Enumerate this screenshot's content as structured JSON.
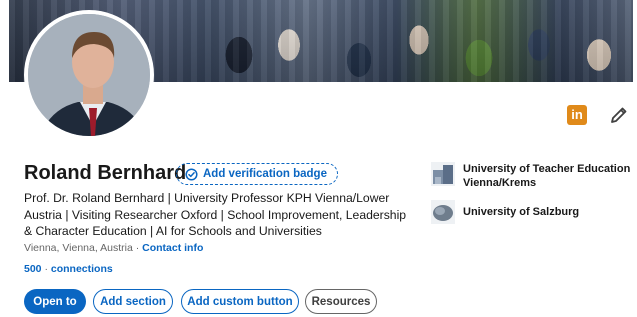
{
  "profile": {
    "name": "Roland Bernhard",
    "verification_badge_label": "Add verification badge",
    "headline": "Prof. Dr. Roland Bernhard | University Professor KPH Vienna/Lower Austria | Visiting Researcher Oxford | School Improvement, Leadership & Character Education | AI for Schools and Universities",
    "location": "Vienna, Vienna, Austria",
    "location_separator": "·",
    "contact_info_label": "Contact info",
    "connections_count": "500",
    "connections_separator": "·",
    "connections_label": "connections"
  },
  "education": [
    {
      "name": "University of Teacher Education Vienna/Krems",
      "logo": "building-logo-icon"
    },
    {
      "name": "University of Salzburg",
      "logo": "university-logo-icon"
    }
  ],
  "actions": {
    "open_to": "Open to",
    "add_section": "Add section",
    "add_custom_button": "Add custom button",
    "resources": "Resources"
  },
  "icons": {
    "linkedin": "in"
  },
  "colors": {
    "accent": "#0a66c2",
    "linkedin_badge": "#e08a1a"
  }
}
